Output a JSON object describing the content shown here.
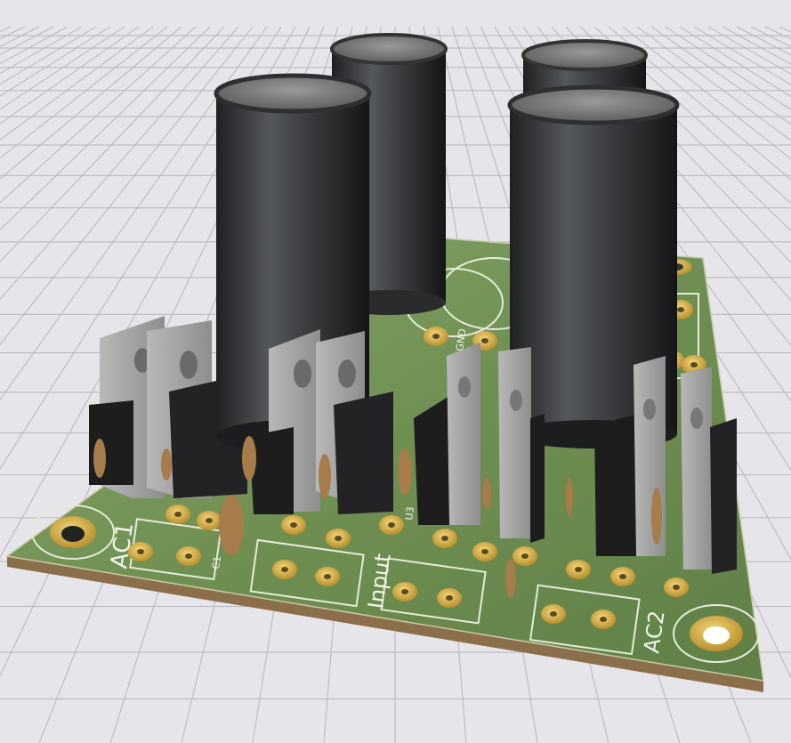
{
  "viewer": {
    "background_color": "#e6e6ea",
    "grid_color": "#b4b4b8"
  },
  "board": {
    "mask_color": "#6f8f52",
    "edge_color": "#8a6f4a",
    "pad_color": "#d7b04a",
    "silk_color": "#f2f5ea"
  },
  "labels": {
    "ac1": "AC1",
    "ac2": "AC2",
    "input": "Input",
    "c1": "C1",
    "u3": "U3",
    "gnd": "GND"
  },
  "components": {
    "capacitor_count": 4,
    "regulator_count": 4
  }
}
